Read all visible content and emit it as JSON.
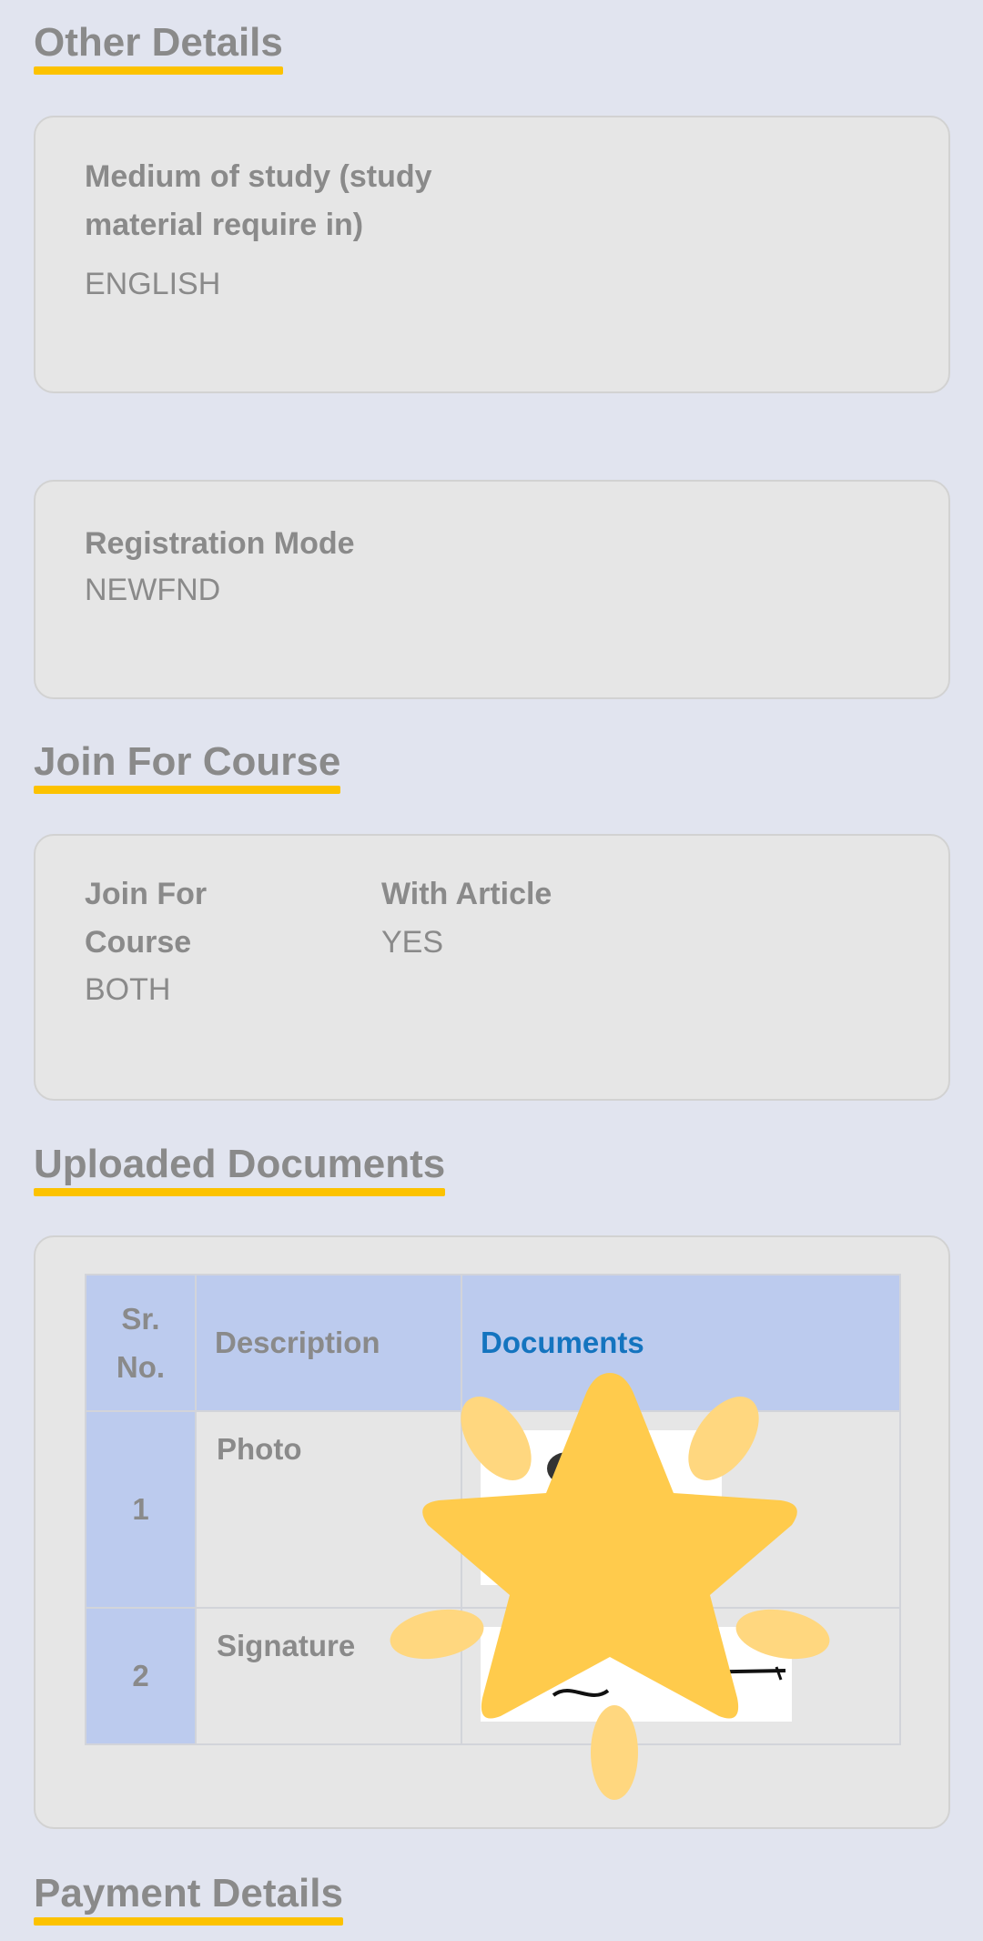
{
  "sections": {
    "other_details": "Other Details",
    "join_for_course": "Join For Course",
    "uploaded_documents": "Uploaded Documents",
    "payment_details": "Payment Details"
  },
  "other": {
    "medium_label": "Medium of study (study material require in)",
    "medium_value": "ENGLISH",
    "registration_label": "Registration Mode",
    "registration_value": "NEWFND"
  },
  "course": {
    "join_label": "Join For Course",
    "join_value": "BOTH",
    "article_label": "With Article",
    "article_value": "YES"
  },
  "documents": {
    "headers": [
      "Sr. No.",
      "Description",
      "Documents"
    ],
    "rows": [
      {
        "sr": "1",
        "description": "Photo"
      },
      {
        "sr": "2",
        "description": "Signature"
      }
    ]
  },
  "colors": {
    "accent": "#fcc200",
    "header_bg": "#bccbee",
    "link": "#1474bf",
    "star": "#ffcb4c"
  }
}
